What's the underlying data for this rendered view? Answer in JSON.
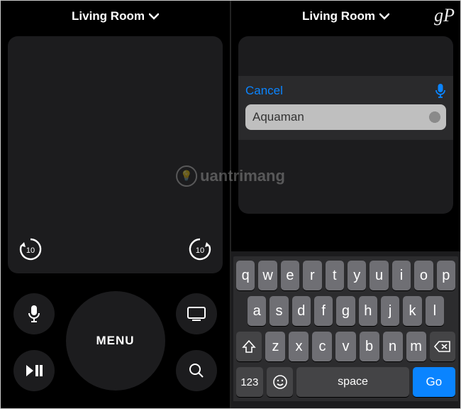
{
  "left": {
    "room": "Living Room",
    "menu": "MENU",
    "skip_seconds": "10"
  },
  "right": {
    "room": "Living Room",
    "cancel": "Cancel",
    "search_value": "Aquaman"
  },
  "keyboard": {
    "row1": [
      "q",
      "w",
      "e",
      "r",
      "t",
      "y",
      "u",
      "i",
      "o",
      "p"
    ],
    "row2": [
      "a",
      "s",
      "d",
      "f",
      "g",
      "h",
      "j",
      "k",
      "l"
    ],
    "row3": [
      "z",
      "x",
      "c",
      "v",
      "b",
      "n",
      "m"
    ],
    "num": "123",
    "space": "space",
    "go": "Go"
  },
  "watermark": {
    "site": "uantrimang",
    "corner": "gP"
  }
}
